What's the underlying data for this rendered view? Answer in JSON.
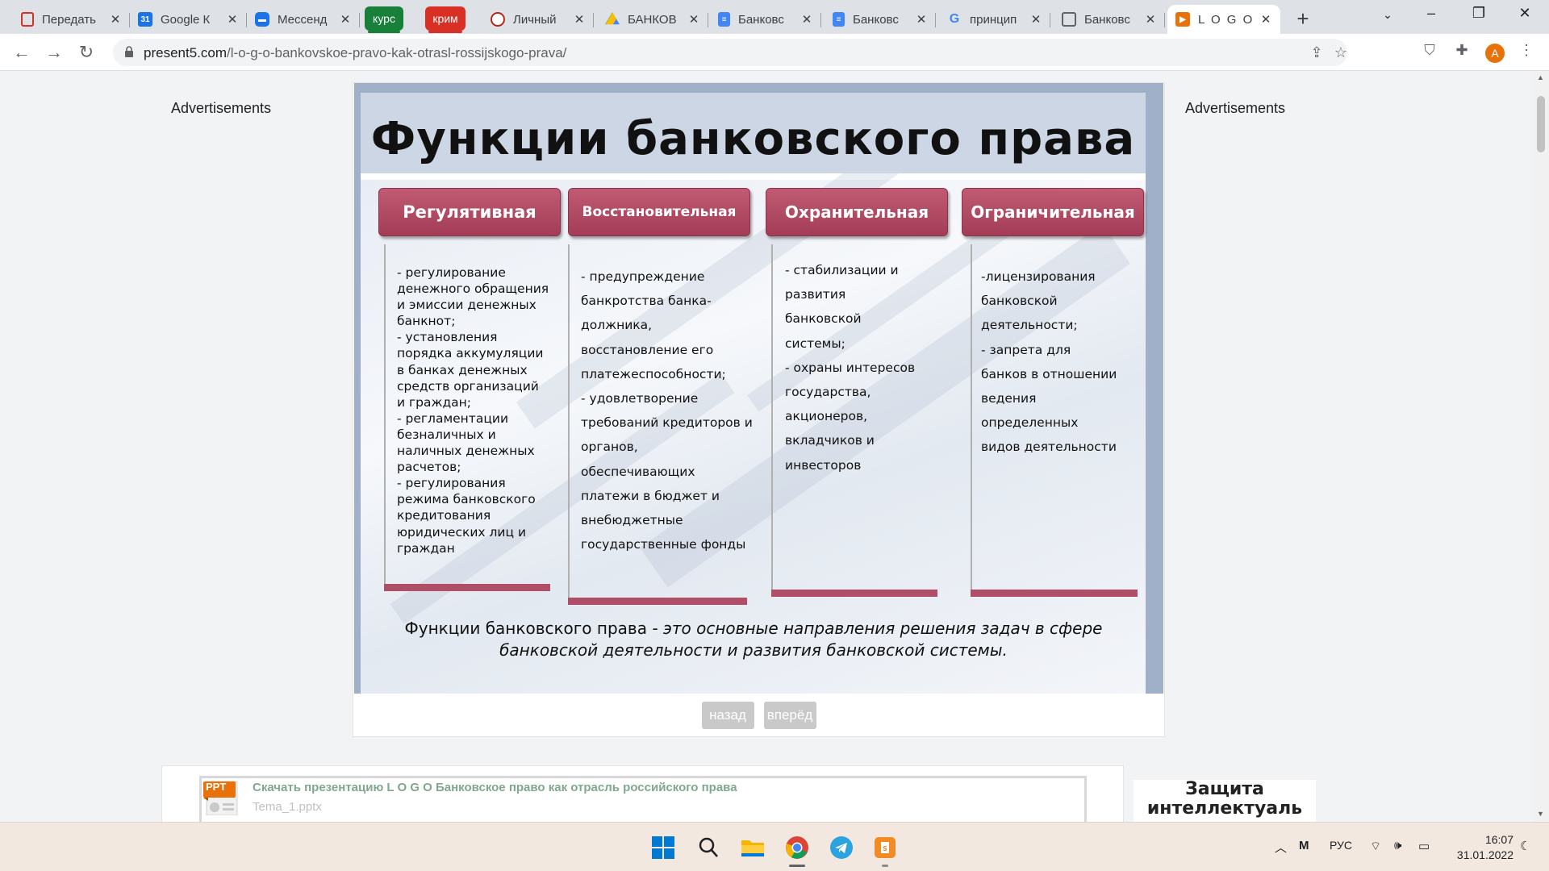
{
  "browser": {
    "tabs": [
      {
        "title": "Передать",
        "favicon": "red-square-icon",
        "color": "#d93025"
      },
      {
        "title": "Google К",
        "favicon": "google-calendar-icon",
        "color": "#1a73e8"
      },
      {
        "title": "Мессенд",
        "favicon": "messenger-icon",
        "color": "#1a73e8"
      },
      {
        "title": "курс",
        "favicon": "",
        "color": "#188038"
      },
      {
        "title": "крим",
        "favicon": "",
        "color": "#d93025"
      },
      {
        "title": "Личный",
        "favicon": "gear-logo-icon",
        "color": "#b3261e"
      },
      {
        "title": "БАНКОВ",
        "favicon": "google-drive-icon",
        "color": "#fbbc04"
      },
      {
        "title": "Банковс",
        "favicon": "google-docs-icon",
        "color": "#4285f4"
      },
      {
        "title": "Банковс",
        "favicon": "google-docs-icon",
        "color": "#4285f4"
      },
      {
        "title": "принцип",
        "favicon": "google-icon",
        "color": "#4285f4"
      },
      {
        "title": "Банковс",
        "favicon": "document-icon",
        "color": "#5f6368"
      },
      {
        "title": "L O G O",
        "favicon": "presentation-icon",
        "color": "#e8710a"
      }
    ],
    "url_host": "present5.com",
    "url_path": "/l-o-g-o-bankovskoe-pravo-kak-otrasl-rossijskogo-prava/",
    "avatar_letter": "A"
  },
  "page": {
    "ads_left": "Advertisements",
    "ads_right": "Advertisements",
    "slide": {
      "title": "Функции банковского права",
      "functions": [
        {
          "name": "Регулятивная",
          "lines": [
            "- регулирование",
            "денежного обращения",
            "и эмиссии денежных",
            "банкнот;",
            "- установления",
            "порядка аккумуляции",
            "в банках денежных",
            "средств организаций",
            "и граждан;",
            "- регламентации",
            "безналичных и",
            "наличных денежных",
            "расчетов;",
            "- регулирования",
            "режима банковского",
            "кредитования",
            "юридических лиц и",
            "граждан"
          ]
        },
        {
          "name": "Восстановительная",
          "lines": [
            "- предупреждение",
            "банкротства банка-",
            "должника,",
            "восстановление его",
            "платежеспособности;",
            "- удовлетворение",
            "требований кредиторов и",
            "органов,",
            "обеспечивающих",
            "платежи в бюджет и",
            "внебюджетные",
            "государственные фонды"
          ]
        },
        {
          "name": "Охранительная",
          "lines": [
            "- стабилизации и",
            "развития",
            "банковской",
            "системы;",
            "- охраны интересов",
            "государства,",
            "акционеров,",
            "вкладчиков и",
            "инвесторов"
          ]
        },
        {
          "name": "Ограничительная",
          "lines": [
            "-лицензирования",
            "банковской",
            "деятельности;",
            "- запрета для",
            "банков в отношении",
            "ведения",
            "определенных",
            "видов деятельности"
          ]
        }
      ],
      "definition_term": "Функции банковского права",
      "definition_rest": " - это основные направления решения задач в сфере",
      "definition_line2": "банковской деятельности и развития банковской системы."
    },
    "nav": {
      "prev": "назад",
      "next": "вперёд"
    },
    "download": {
      "badge": "PPT",
      "link": "Скачать презентацию L O G O Банковское право как отрасль российского права",
      "file": "Tema_1.pptx"
    },
    "side_banner": "Защита интеллектуаль"
  },
  "taskbar": {
    "lang": "РУС",
    "time": "16:07",
    "date": "31.01.2022"
  }
}
